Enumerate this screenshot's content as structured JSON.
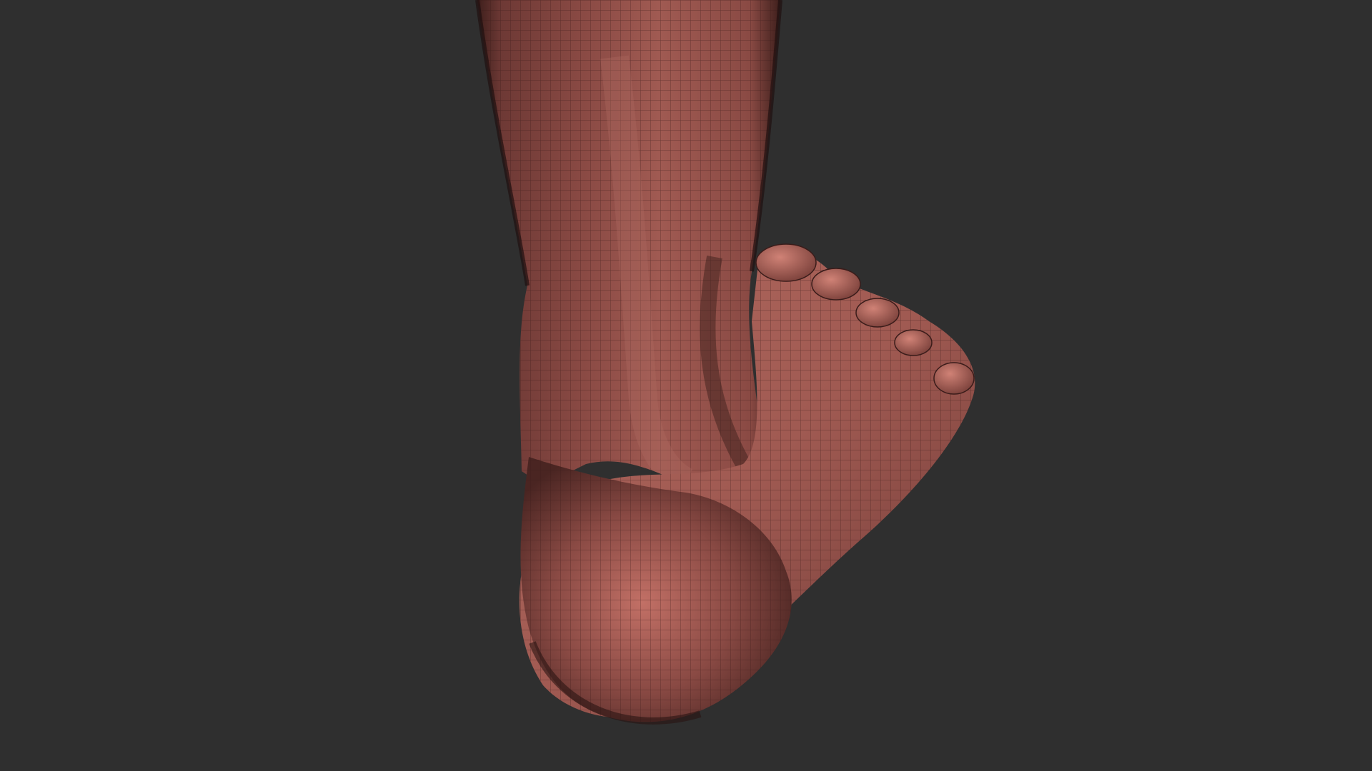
{
  "viewport": {
    "background_color": "#2f2f2f",
    "model_base_color": "#8a4a44",
    "model_light_color": "#c27066",
    "model_shadow_color": "#3e1f1c",
    "wireframe_color": "#3a1c1a"
  },
  "model": {
    "subject": "foot-and-ankle-mesh",
    "view": "rear"
  }
}
